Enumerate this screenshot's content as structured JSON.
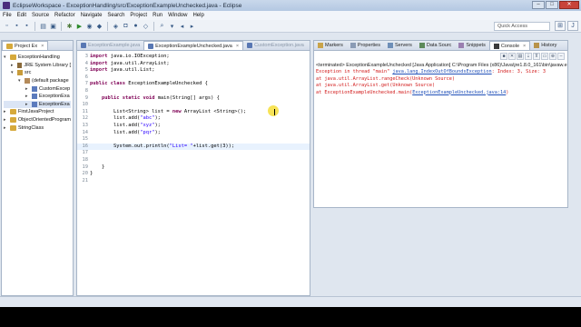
{
  "window": {
    "title": "EclipseWorkspace - ExceptionHandling/src/ExceptionExampleUnchecked.java - Eclipse",
    "minimize": "–",
    "maximize": "□",
    "close": "✕"
  },
  "menu": [
    "File",
    "Edit",
    "Source",
    "Refactor",
    "Navigate",
    "Search",
    "Project",
    "Run",
    "Window",
    "Help"
  ],
  "quick_access": {
    "placeholder": "Quick Access"
  },
  "explorer": {
    "tab": "Project Ex",
    "items": [
      {
        "label": "ExceptionHandling",
        "twisty": "▾",
        "icon": "project"
      },
      {
        "label": "JRE System Library [",
        "twisty": "▸",
        "icon": "library"
      },
      {
        "label": "src",
        "twisty": "▾",
        "icon": "source-folder"
      },
      {
        "label": "(default package",
        "twisty": "▾",
        "icon": "package"
      },
      {
        "label": "CustomExcep",
        "twisty": "▸",
        "icon": "java-file"
      },
      {
        "label": "ExceptionExa",
        "twisty": "▸",
        "icon": "java-file"
      },
      {
        "label": "ExceptionExa",
        "twisty": "▸",
        "icon": "java-file"
      },
      {
        "label": "FirstJavaProject",
        "twisty": "▸",
        "icon": "project"
      },
      {
        "label": "ObjectOrientedProgram",
        "twisty": "▸",
        "icon": "project"
      },
      {
        "label": "StringClass",
        "twisty": "▸",
        "icon": "project"
      }
    ]
  },
  "editor": {
    "tabs": [
      {
        "label": "ExceptionExample.java",
        "active": false
      },
      {
        "label": "ExceptionExampleUnchecked.java",
        "active": true
      },
      {
        "label": "CustomException.java",
        "active": false
      }
    ],
    "lines": [
      {
        "n": "3",
        "t": "import java.io.IOException;"
      },
      {
        "n": "4",
        "t": "import java.util.ArrayList;"
      },
      {
        "n": "5",
        "t": "import java.util.List;"
      },
      {
        "n": "6",
        "t": ""
      },
      {
        "n": "7",
        "t": "public class ExceptionExampleUnchecked {"
      },
      {
        "n": "8",
        "t": ""
      },
      {
        "n": "9",
        "t": "    public static void main(String[] args) {"
      },
      {
        "n": "10",
        "t": ""
      },
      {
        "n": "11",
        "t": "        List<String> list = new ArrayList <String>();"
      },
      {
        "n": "12",
        "t": "        list.add(\"abc\");"
      },
      {
        "n": "13",
        "t": "        list.add(\"xyz\");"
      },
      {
        "n": "14",
        "t": "        list.add(\"pqr\");"
      },
      {
        "n": "15",
        "t": ""
      },
      {
        "n": "16",
        "t": "        System.out.println(\"List= \"+list.get(3));"
      },
      {
        "n": "17",
        "t": ""
      },
      {
        "n": "18",
        "t": ""
      },
      {
        "n": "19",
        "t": "    }"
      },
      {
        "n": "20",
        "t": "}"
      },
      {
        "n": "21",
        "t": ""
      }
    ]
  },
  "views": {
    "tabs": [
      "Markers",
      "Properties",
      "Servers",
      "Data Sourc",
      "Snippets",
      "Console",
      "History"
    ],
    "active": "Console",
    "terminated": "<terminated> ExceptionExampleUnchecked [Java Application] C:\\Program Files (x86)\\Java\\jre1.8.0_161\\bin\\javaw.e",
    "console": [
      {
        "pre": "Exception in thread \"main\" ",
        "link": "java.lang.IndexOutOfBoundsException",
        "post": ": Index: 3, Size: 3"
      },
      {
        "pre": "        at java.util.ArrayList.rangeCheck(Unknown Source)",
        "link": "",
        "post": ""
      },
      {
        "pre": "        at java.util.ArrayList.get(Unknown Source)",
        "link": "",
        "post": ""
      },
      {
        "pre": "        at ExceptionExampleUnchecked.main(",
        "link": "ExceptionExampleUnchecked.java:14",
        "post": ")"
      }
    ]
  },
  "colors": {
    "keyword": "#7f0055",
    "string": "#2a00ff",
    "error": "#d21a1a",
    "link": "#1f4fb8"
  }
}
